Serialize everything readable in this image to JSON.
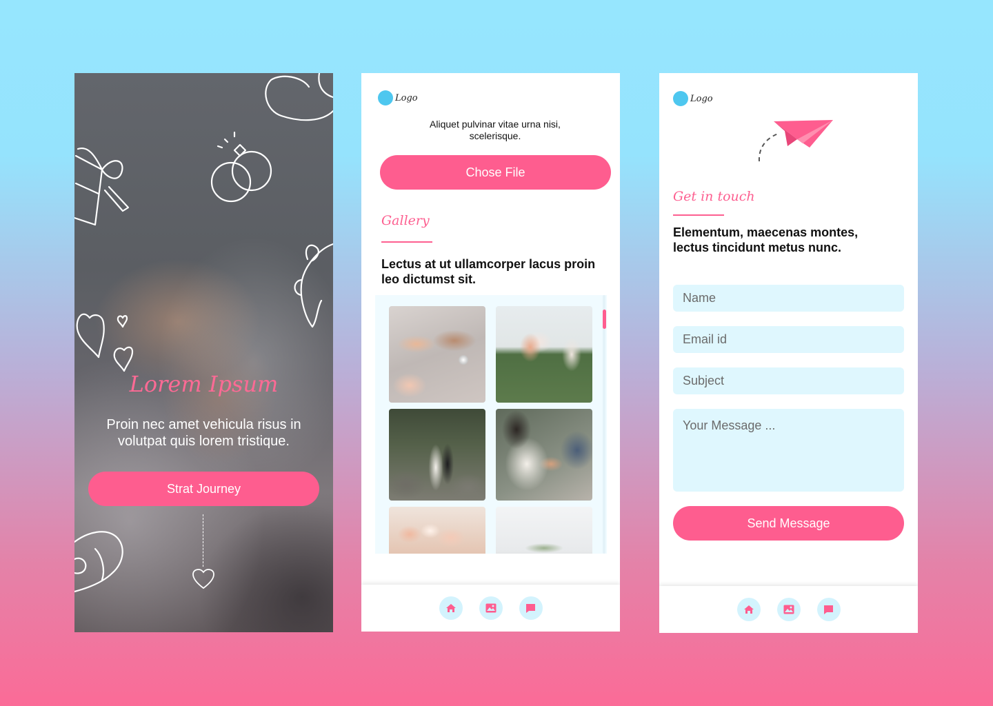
{
  "colors": {
    "accent": "#fe5d8f",
    "script_pink": "#fd5f90",
    "field_bg": "#dff7fe",
    "logo_dot": "#4ec7ef"
  },
  "hero": {
    "title": "Lorem Ipsum",
    "text": "Proin nec amet vehicula risus in volutpat quis lorem tristique.",
    "button_label": "Strat Journey"
  },
  "gallery_screen": {
    "logo_text": "Logo",
    "caption": "Aliquet pulvinar vitae urna nisi, scelerisque.",
    "file_button_label": "Chose File",
    "section_label": "Gallery",
    "heading": "Lectus at ut ullamcorper lacus proin leo dictumst sit.",
    "photos": [
      "hands-with-rings",
      "bridal-bouquet",
      "couple-in-garden",
      "ring-exchange",
      "table-flowers",
      "reception-tent"
    ],
    "nav_icons": [
      "home-icon",
      "image-icon",
      "chat-icon"
    ]
  },
  "contact_screen": {
    "logo_text": "Logo",
    "section_label": "Get in touch",
    "heading": "Elementum, maecenas montes, lectus tincidunt metus nunc.",
    "name_placeholder": "Name",
    "email_placeholder": "Email id",
    "subject_placeholder": "Subject",
    "message_placeholder": "Your Message ...",
    "send_button_label": "Send Message",
    "nav_icons": [
      "home-icon",
      "image-icon",
      "chat-icon"
    ]
  }
}
